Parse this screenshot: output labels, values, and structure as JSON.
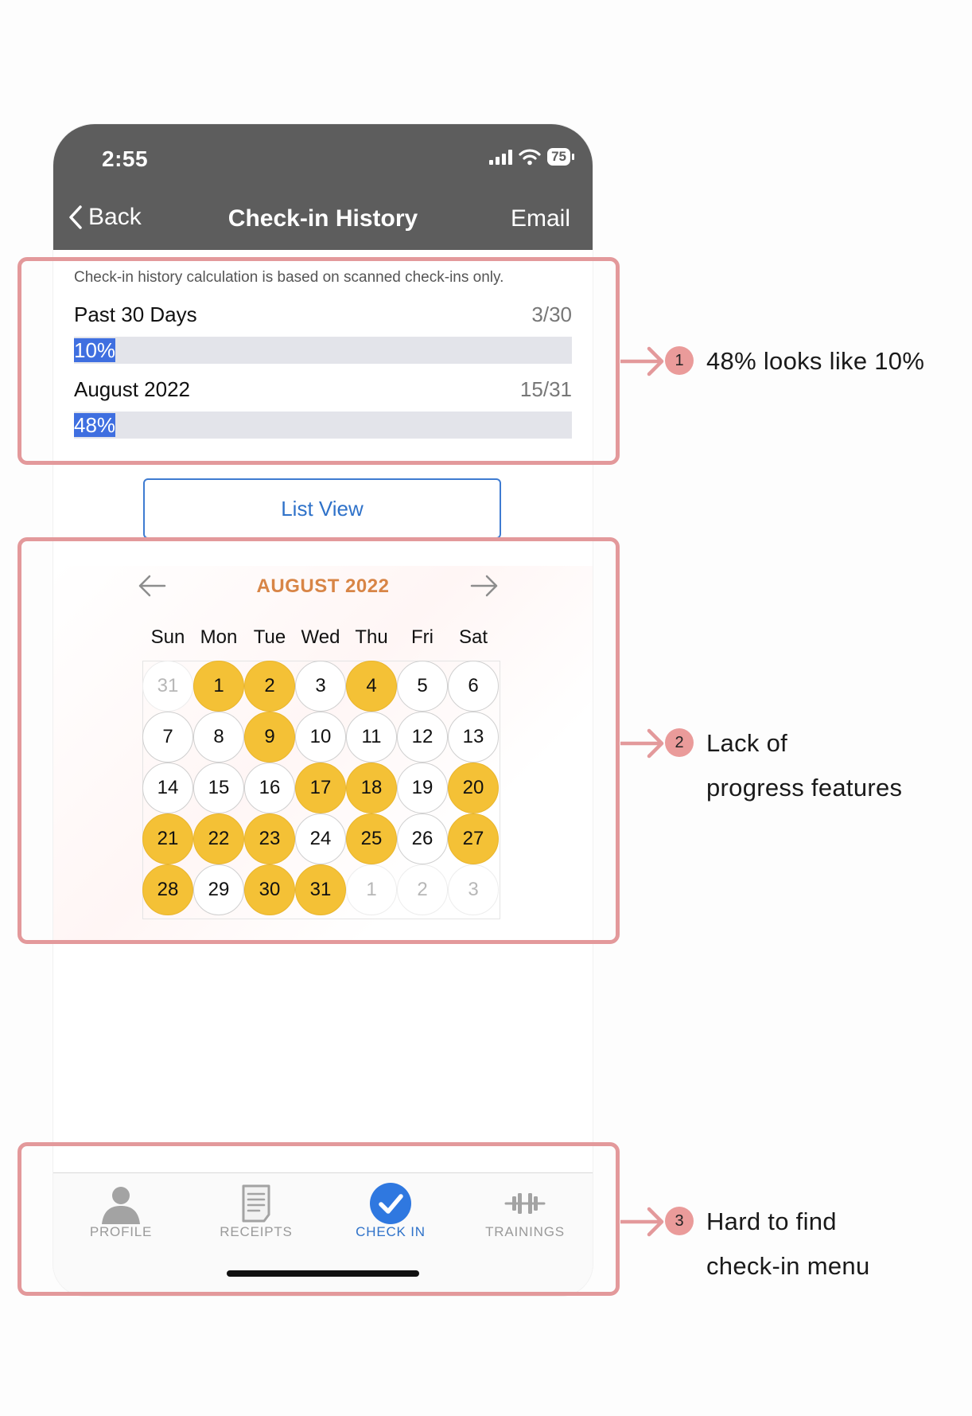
{
  "status_bar": {
    "time": "2:55",
    "battery": "75"
  },
  "nav": {
    "back_label": "Back",
    "title": "Check-in History",
    "email_label": "Email"
  },
  "history": {
    "note": "Check-in history calculation is based on scanned check-ins only.",
    "stats": [
      {
        "label": "Past 30 Days",
        "count": "3/30",
        "percent_label": "10%",
        "progress": 0.1
      },
      {
        "label": "August 2022",
        "count": "15/31",
        "percent_label": "48%",
        "progress": 0.48
      }
    ]
  },
  "list_view_label": "List View",
  "calendar": {
    "month_title": "AUGUST 2022",
    "weekdays": [
      "Sun",
      "Mon",
      "Tue",
      "Wed",
      "Thu",
      "Fri",
      "Sat"
    ],
    "days": [
      {
        "label": "31",
        "status": "outside"
      },
      {
        "label": "1",
        "status": "checked_in"
      },
      {
        "label": "2",
        "status": "checked_in"
      },
      {
        "label": "3",
        "status": "none"
      },
      {
        "label": "4",
        "status": "checked_in"
      },
      {
        "label": "5",
        "status": "none"
      },
      {
        "label": "6",
        "status": "none"
      },
      {
        "label": "7",
        "status": "none"
      },
      {
        "label": "8",
        "status": "none"
      },
      {
        "label": "9",
        "status": "checked_in"
      },
      {
        "label": "10",
        "status": "none"
      },
      {
        "label": "11",
        "status": "none"
      },
      {
        "label": "12",
        "status": "none"
      },
      {
        "label": "13",
        "status": "none"
      },
      {
        "label": "14",
        "status": "none"
      },
      {
        "label": "15",
        "status": "none"
      },
      {
        "label": "16",
        "status": "none"
      },
      {
        "label": "17",
        "status": "checked_in"
      },
      {
        "label": "18",
        "status": "checked_in"
      },
      {
        "label": "19",
        "status": "none"
      },
      {
        "label": "20",
        "status": "checked_in"
      },
      {
        "label": "21",
        "status": "checked_in"
      },
      {
        "label": "22",
        "status": "checked_in"
      },
      {
        "label": "23",
        "status": "checked_in"
      },
      {
        "label": "24",
        "status": "none"
      },
      {
        "label": "25",
        "status": "checked_in"
      },
      {
        "label": "26",
        "status": "none"
      },
      {
        "label": "27",
        "status": "checked_in"
      },
      {
        "label": "28",
        "status": "checked_in"
      },
      {
        "label": "29",
        "status": "none"
      },
      {
        "label": "30",
        "status": "checked_in"
      },
      {
        "label": "31",
        "status": "checked_in"
      },
      {
        "label": "1",
        "status": "outside"
      },
      {
        "label": "2",
        "status": "outside"
      },
      {
        "label": "3",
        "status": "outside"
      }
    ]
  },
  "tabs": [
    {
      "label": "PROFILE",
      "icon": "person-icon",
      "active": false
    },
    {
      "label": "RECEIPTS",
      "icon": "receipt-icon",
      "active": false
    },
    {
      "label": "CHECK IN",
      "icon": "checkmark-circle-icon",
      "active": true
    },
    {
      "label": "TRAININGS",
      "icon": "dumbbell-icon",
      "active": false
    }
  ],
  "annotations": [
    {
      "number": "1",
      "lines": [
        "48% looks like 10%"
      ]
    },
    {
      "number": "2",
      "lines": [
        "Lack of",
        "progress features"
      ]
    },
    {
      "number": "3",
      "lines": [
        "Hard to find",
        "check-in menu"
      ]
    }
  ],
  "colors": {
    "annotation": "#e3999b",
    "checked_in": "#f4c136",
    "accent_blue": "#2f72c9",
    "header": "#5d5d5d",
    "month_title": "#d88546"
  }
}
